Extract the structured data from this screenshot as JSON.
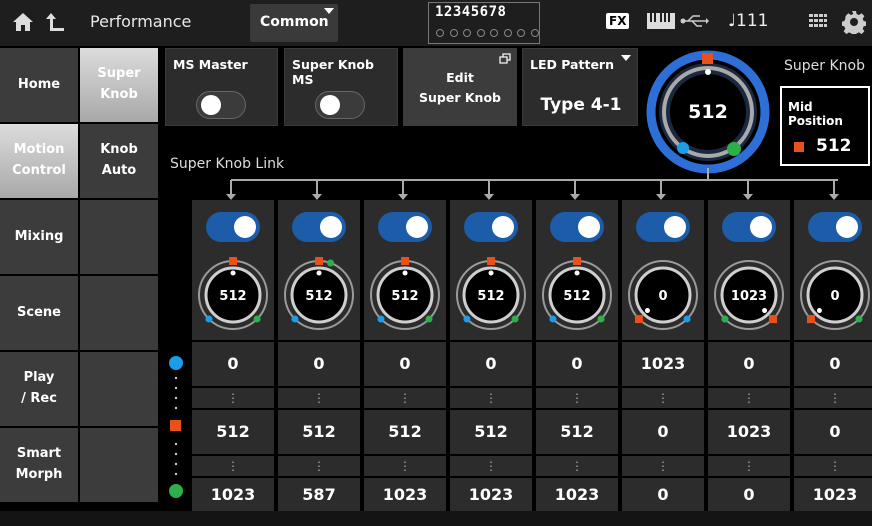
{
  "header": {
    "title": "Performance",
    "part_select": "Common",
    "part_numbers": "12345678",
    "fx_label": "FX",
    "tempo_note": "♩",
    "tempo": "111"
  },
  "nav": {
    "primary": [
      {
        "label": "Home",
        "selected": false
      },
      {
        "label": "Motion Control",
        "selected": true
      },
      {
        "label": "Mixing",
        "selected": false
      },
      {
        "label": "Scene",
        "selected": false
      },
      {
        "label": "Play / Rec",
        "selected": false
      },
      {
        "label": "Smart Morph",
        "selected": false
      }
    ],
    "secondary": [
      {
        "label": "Super Knob",
        "selected": true
      },
      {
        "label": "Knob Auto",
        "selected": false
      }
    ]
  },
  "controls": {
    "ms_master_label": "MS Master",
    "ms_master_on": false,
    "super_knob_ms_label": "Super Knob MS",
    "super_knob_ms_on": false,
    "edit_line1": "Edit",
    "edit_line2": "Super Knob",
    "led_pattern_label": "LED Pattern",
    "led_pattern_value": "Type 4-1"
  },
  "super_knob": {
    "title": "Super Knob",
    "value": "512",
    "mid_position_label": "Mid Position",
    "mid_position_value": "512",
    "link_title": "Super Knob Link"
  },
  "colors": {
    "accent_blue": "#1d5ca8",
    "min_marker": "#1a9ee8",
    "mid_marker": "#e8501c",
    "max_marker": "#2db04a"
  },
  "parts": [
    {
      "on": true,
      "value": "512",
      "min": "0",
      "mid": "512",
      "max": "1023"
    },
    {
      "on": true,
      "value": "512",
      "min": "0",
      "mid": "512",
      "max": "587"
    },
    {
      "on": true,
      "value": "512",
      "min": "0",
      "mid": "512",
      "max": "1023"
    },
    {
      "on": true,
      "value": "512",
      "min": "0",
      "mid": "512",
      "max": "1023"
    },
    {
      "on": true,
      "value": "512",
      "min": "0",
      "mid": "512",
      "max": "1023"
    },
    {
      "on": true,
      "value": "0",
      "min": "1023",
      "mid": "0",
      "max": "0"
    },
    {
      "on": true,
      "value": "1023",
      "min": "0",
      "mid": "1023",
      "max": "0"
    },
    {
      "on": true,
      "value": "0",
      "min": "0",
      "mid": "0",
      "max": "1023"
    }
  ],
  "dots_glyph": "⋮"
}
